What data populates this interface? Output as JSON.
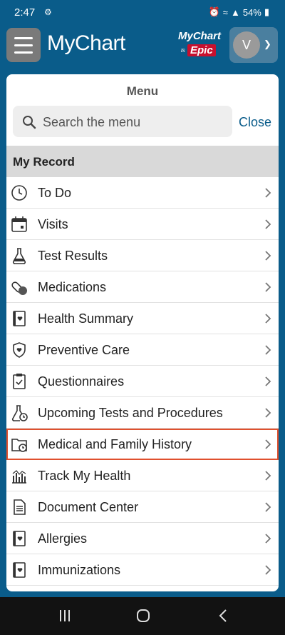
{
  "status": {
    "time": "2:47",
    "battery": "54%"
  },
  "app": {
    "logo": "MyChart",
    "badge_line1": "MyChart",
    "badge_line2": "is",
    "badge_line3": "Epic",
    "avatar_initial": "V"
  },
  "menu": {
    "title": "Menu",
    "search_placeholder": "Search the menu",
    "close_label": "Close",
    "section_title": "My Record",
    "items": [
      {
        "label": "To Do",
        "icon": "clock-icon"
      },
      {
        "label": "Visits",
        "icon": "calendar-icon"
      },
      {
        "label": "Test Results",
        "icon": "flask-icon"
      },
      {
        "label": "Medications",
        "icon": "pill-icon"
      },
      {
        "label": "Health Summary",
        "icon": "heart-document-icon"
      },
      {
        "label": "Preventive Care",
        "icon": "shield-heart-icon"
      },
      {
        "label": "Questionnaires",
        "icon": "clipboard-check-icon"
      },
      {
        "label": "Upcoming Tests and Procedures",
        "icon": "flask-clock-icon"
      },
      {
        "label": "Medical and Family History",
        "icon": "folder-clock-icon",
        "highlighted": true
      },
      {
        "label": "Track My Health",
        "icon": "bar-chart-icon"
      },
      {
        "label": "Document Center",
        "icon": "document-icon"
      },
      {
        "label": "Allergies",
        "icon": "heart-document-icon"
      },
      {
        "label": "Immunizations",
        "icon": "heart-document-icon"
      }
    ]
  },
  "colors": {
    "brand": "#0a5c8a",
    "highlight": "#e0502e",
    "epic_red": "#c8102e"
  }
}
